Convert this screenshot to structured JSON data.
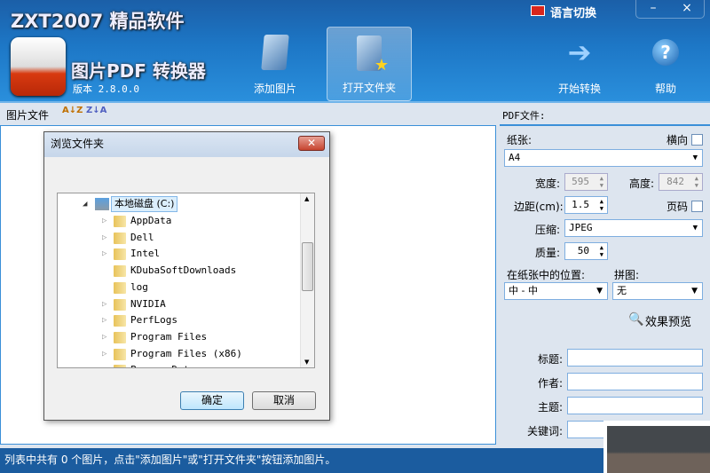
{
  "header": {
    "brand": "ZXT2007 精品软件",
    "app_title": "图片PDF 转换器",
    "version": "版本 2.8.0.0",
    "language": "语言切换",
    "buttons": {
      "add_images": "添加图片",
      "open_folder": "打开文件夹",
      "start": "开始转换",
      "help": "帮助"
    },
    "window": {
      "minimize": "–",
      "close": "×"
    }
  },
  "left": {
    "title": "图片文件",
    "sort_az": "A↓Z",
    "sort_za": "Z↓A"
  },
  "dialog": {
    "title": "浏览文件夹",
    "close": "✕",
    "root": "本地磁盘 (C:)",
    "items": [
      {
        "name": "AppData",
        "exp": true
      },
      {
        "name": "Dell",
        "exp": true
      },
      {
        "name": "Intel",
        "exp": true
      },
      {
        "name": "KDubaSoftDownloads",
        "exp": false
      },
      {
        "name": "log",
        "exp": false
      },
      {
        "name": "NVIDIA",
        "exp": true
      },
      {
        "name": "PerfLogs",
        "exp": true
      },
      {
        "name": "Program Files",
        "exp": true
      },
      {
        "name": "Program Files (x86)",
        "exp": true
      },
      {
        "name": "ProgramData",
        "exp": true
      }
    ],
    "ok": "确定",
    "cancel": "取消"
  },
  "right": {
    "title": "PDF文件:",
    "paper_label": "纸张:",
    "landscape_label": "横向",
    "paper": "A4",
    "width_label": "宽度:",
    "width": "595",
    "height_label": "高度:",
    "height": "842",
    "margin_label": "边距(cm):",
    "margin": "1.5",
    "page_num_label": "页码",
    "compress_label": "压缩:",
    "compress": "JPEG",
    "quality_label": "质量:",
    "quality": "50",
    "position_label": "在纸张中的位置:",
    "position": "中 - 中",
    "collage_label": "拼图:",
    "collage": "无",
    "preview": "效果预览",
    "meta_title": "标题:",
    "meta_author": "作者:",
    "meta_subject": "主题:",
    "meta_keywords": "关键词:"
  },
  "status": "列表中共有 0 个图片，点击\"添加图片\"或\"打开文件夹\"按钮添加图片。"
}
